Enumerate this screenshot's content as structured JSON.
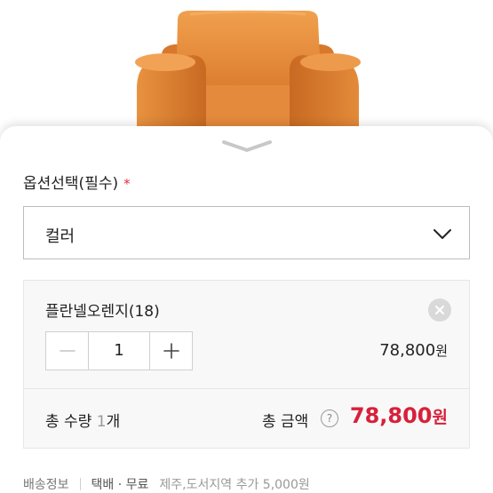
{
  "product": {
    "photo_icon": "orange-armchair"
  },
  "sheet": {
    "handle_icon": "chevron-down-icon"
  },
  "option": {
    "label": "옵션선택(필수)",
    "required_mark": "*",
    "select_value": "컬러",
    "select_icon": "chevron-down-icon"
  },
  "selected_item": {
    "name": "플란넬오렌지(18)",
    "remove_icon": "close-icon",
    "minus_label": "−",
    "quantity": "1",
    "plus_label": "+",
    "price": "78,800",
    "currency": "원"
  },
  "summary": {
    "qty_prefix": "총 수량 ",
    "qty_count": "1",
    "qty_suffix": "개",
    "amount_label": "총 금액",
    "help_label": "?",
    "amount": "78,800",
    "currency": "원"
  },
  "shipping": {
    "label": "배송정보",
    "method": "택배 · 무료",
    "extra": "제주,도서지역 추가 5,000원"
  },
  "colors": {
    "accent_red": "#d8203a",
    "required_red": "#e0303e",
    "sofa_orange": "#e8893c"
  }
}
